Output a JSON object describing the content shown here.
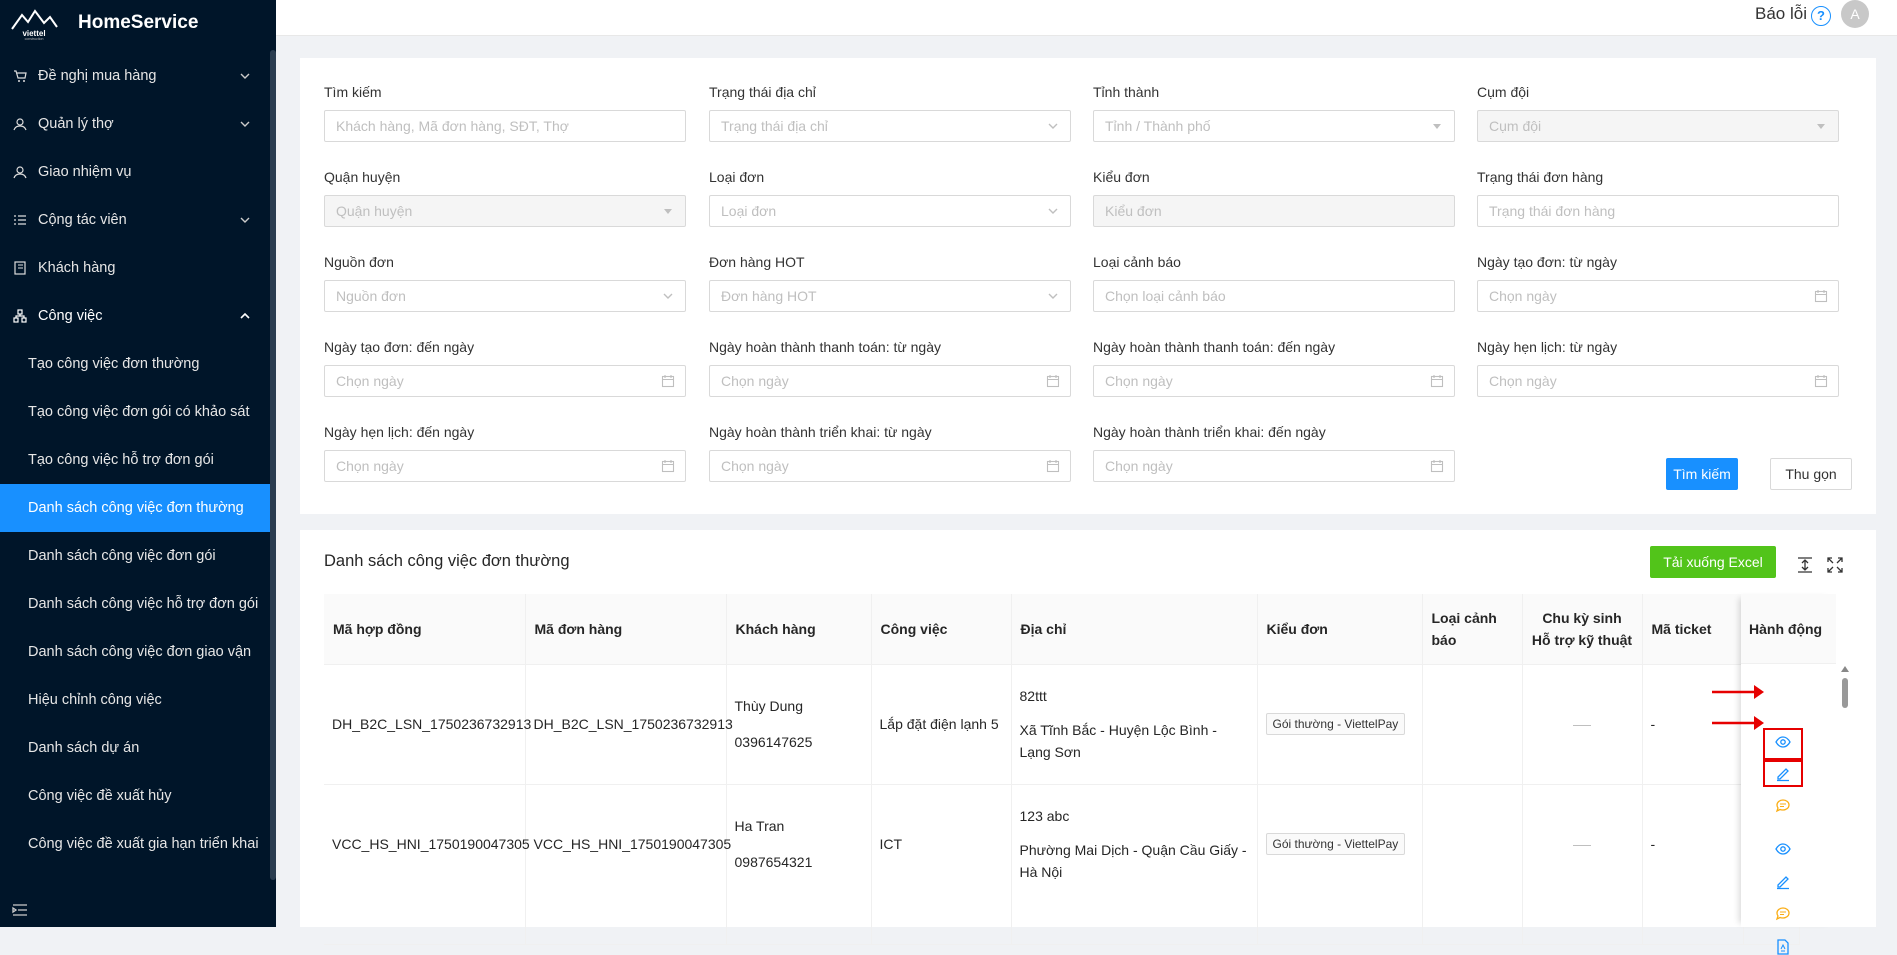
{
  "app": {
    "name": "HomeService",
    "logo_text": "viettel construction"
  },
  "sidebar": {
    "items": [
      {
        "label": "Đề nghị mua hàng",
        "icon": "cart-icon",
        "expandable": true
      },
      {
        "label": "Quản lý thợ",
        "icon": "user-icon",
        "expandable": true
      },
      {
        "label": "Giao nhiệm vụ",
        "icon": "user-icon",
        "expandable": false
      },
      {
        "label": "Cộng tác viên",
        "icon": "list-icon",
        "expandable": true
      },
      {
        "label": "Khách hàng",
        "icon": "book-icon",
        "expandable": false
      },
      {
        "label": "Công việc",
        "icon": "cluster-icon",
        "expandable": true,
        "expanded": true
      }
    ],
    "subitems": [
      "Tạo công việc đơn thường",
      "Tạo công việc đơn gói có khảo sát",
      "Tạo công việc hỗ trợ đơn gói",
      "Danh sách công việc đơn thường",
      "Danh sách công việc đơn gói",
      "Danh sách công việc hỗ trợ đơn gói",
      "Danh sách công việc đơn giao vận",
      "Hiệu chỉnh công việc",
      "Danh sách dự án",
      "Công việc đề xuất hủy",
      "Công việc đề xuất gia hạn triển khai"
    ],
    "active_subitem": "Danh sách công việc đơn thường"
  },
  "topbar": {
    "report_label": "Báo lỗi",
    "help_glyph": "?",
    "avatar_letter": "A"
  },
  "filters": {
    "fields": [
      {
        "label": "Tìm kiếm",
        "placeholder": "Khách hàng, Mã đơn hàng, SĐT, Thợ",
        "suffix": "",
        "disabled": false
      },
      {
        "label": "Trạng thái địa chỉ",
        "placeholder": "Trạng thái địa chỉ",
        "suffix": "chevron-down-icon",
        "disabled": false
      },
      {
        "label": "Tỉnh thành",
        "placeholder": "Tỉnh / Thành phố",
        "suffix": "caret-down-icon",
        "disabled": false
      },
      {
        "label": "Cụm đội",
        "placeholder": "Cụm đội",
        "suffix": "caret-down-icon",
        "disabled": true
      },
      {
        "label": "Quận huyện",
        "placeholder": "Quận huyện",
        "suffix": "caret-down-icon",
        "disabled": true
      },
      {
        "label": "Loại đơn",
        "placeholder": "Loại đơn",
        "suffix": "chevron-down-icon",
        "disabled": false
      },
      {
        "label": "Kiểu đơn",
        "placeholder": "Kiểu đơn",
        "suffix": "",
        "disabled": true
      },
      {
        "label": "Trạng thái đơn hàng",
        "placeholder": "Trạng thái đơn hàng",
        "suffix": "",
        "disabled": false
      },
      {
        "label": "Nguồn đơn",
        "placeholder": "Nguồn đơn",
        "suffix": "chevron-down-icon",
        "disabled": false
      },
      {
        "label": "Đơn hàng HOT",
        "placeholder": "Đơn hàng HOT",
        "suffix": "chevron-down-icon",
        "disabled": false
      },
      {
        "label": "Loại cảnh báo",
        "placeholder": "Chọn loại cảnh báo",
        "suffix": "",
        "disabled": false
      },
      {
        "label": "Ngày tạo đơn: từ ngày",
        "placeholder": "Chọn ngày",
        "suffix": "calendar-icon",
        "disabled": false
      },
      {
        "label": "Ngày tạo đơn: đến ngày",
        "placeholder": "Chọn ngày",
        "suffix": "calendar-icon",
        "disabled": false
      },
      {
        "label": "Ngày hoàn thành thanh toán: từ ngày",
        "placeholder": "Chọn ngày",
        "suffix": "calendar-icon",
        "disabled": false
      },
      {
        "label": "Ngày hoàn thành thanh toán: đến ngày",
        "placeholder": "Chọn ngày",
        "suffix": "calendar-icon",
        "disabled": false
      },
      {
        "label": "Ngày hẹn lịch: từ ngày",
        "placeholder": "Chọn ngày",
        "suffix": "calendar-icon",
        "disabled": false
      },
      {
        "label": "Ngày hẹn lịch: đến ngày",
        "placeholder": "Chọn ngày",
        "suffix": "calendar-icon",
        "disabled": false
      },
      {
        "label": "Ngày hoàn thành triển khai: từ ngày",
        "placeholder": "Chọn ngày",
        "suffix": "calendar-icon",
        "disabled": false
      },
      {
        "label": "Ngày hoàn thành triển khai: đến ngày",
        "placeholder": "Chọn ngày",
        "suffix": "calendar-icon",
        "disabled": false
      }
    ],
    "search_button": "Tìm kiếm",
    "collapse_button": "Thu gọn"
  },
  "list": {
    "title": "Danh sách công việc đơn thường",
    "excel_button": "Tải xuống Excel",
    "columns": [
      "Mã hợp đồng",
      "Mã đơn hàng",
      "Khách hàng",
      "Công việc",
      "Địa chỉ",
      "Kiểu đơn",
      "Loại cảnh báo",
      "Chu kỳ sinh Hỗ trợ kỹ thuật",
      "Mã ticket",
      "Hành động"
    ],
    "rows": [
      {
        "contract": "DH_B2C_LSN_1750236732913",
        "order": "DH_B2C_LSN_1750236732913",
        "customer_name": "Thùy Dung",
        "customer_phone": "0396147625",
        "job": "Lắp đặt điện lạnh 5",
        "address_line1": "82ttt",
        "address_line2": "Xã Tĩnh Bắc - Huyện Lộc Bình - Lạng Sơn",
        "order_type": "Gói thường - ViettelPay",
        "warning": "",
        "ticket": "-",
        "actions": [
          "eye-icon",
          "edit-icon",
          "comment-icon"
        ]
      },
      {
        "contract": "VCC_HS_HNI_1750190047305",
        "order": "VCC_HS_HNI_1750190047305",
        "customer_name": "Ha Tran",
        "customer_phone": "0987654321",
        "job": "ICT",
        "address_line1": "123 abc",
        "address_line2": "Phường Mai Dịch - Quận Cầu Giấy - Hà Nội",
        "order_type": "Gói thường - ViettelPay",
        "warning": "",
        "ticket": "-",
        "actions": [
          "eye-icon",
          "edit-icon",
          "comment-icon",
          "file-pdf-icon"
        ]
      }
    ]
  },
  "colors": {
    "sidebar_bg": "#001529",
    "primary": "#1890ff",
    "excel": "#52c41a",
    "highlight": "#e60000"
  }
}
